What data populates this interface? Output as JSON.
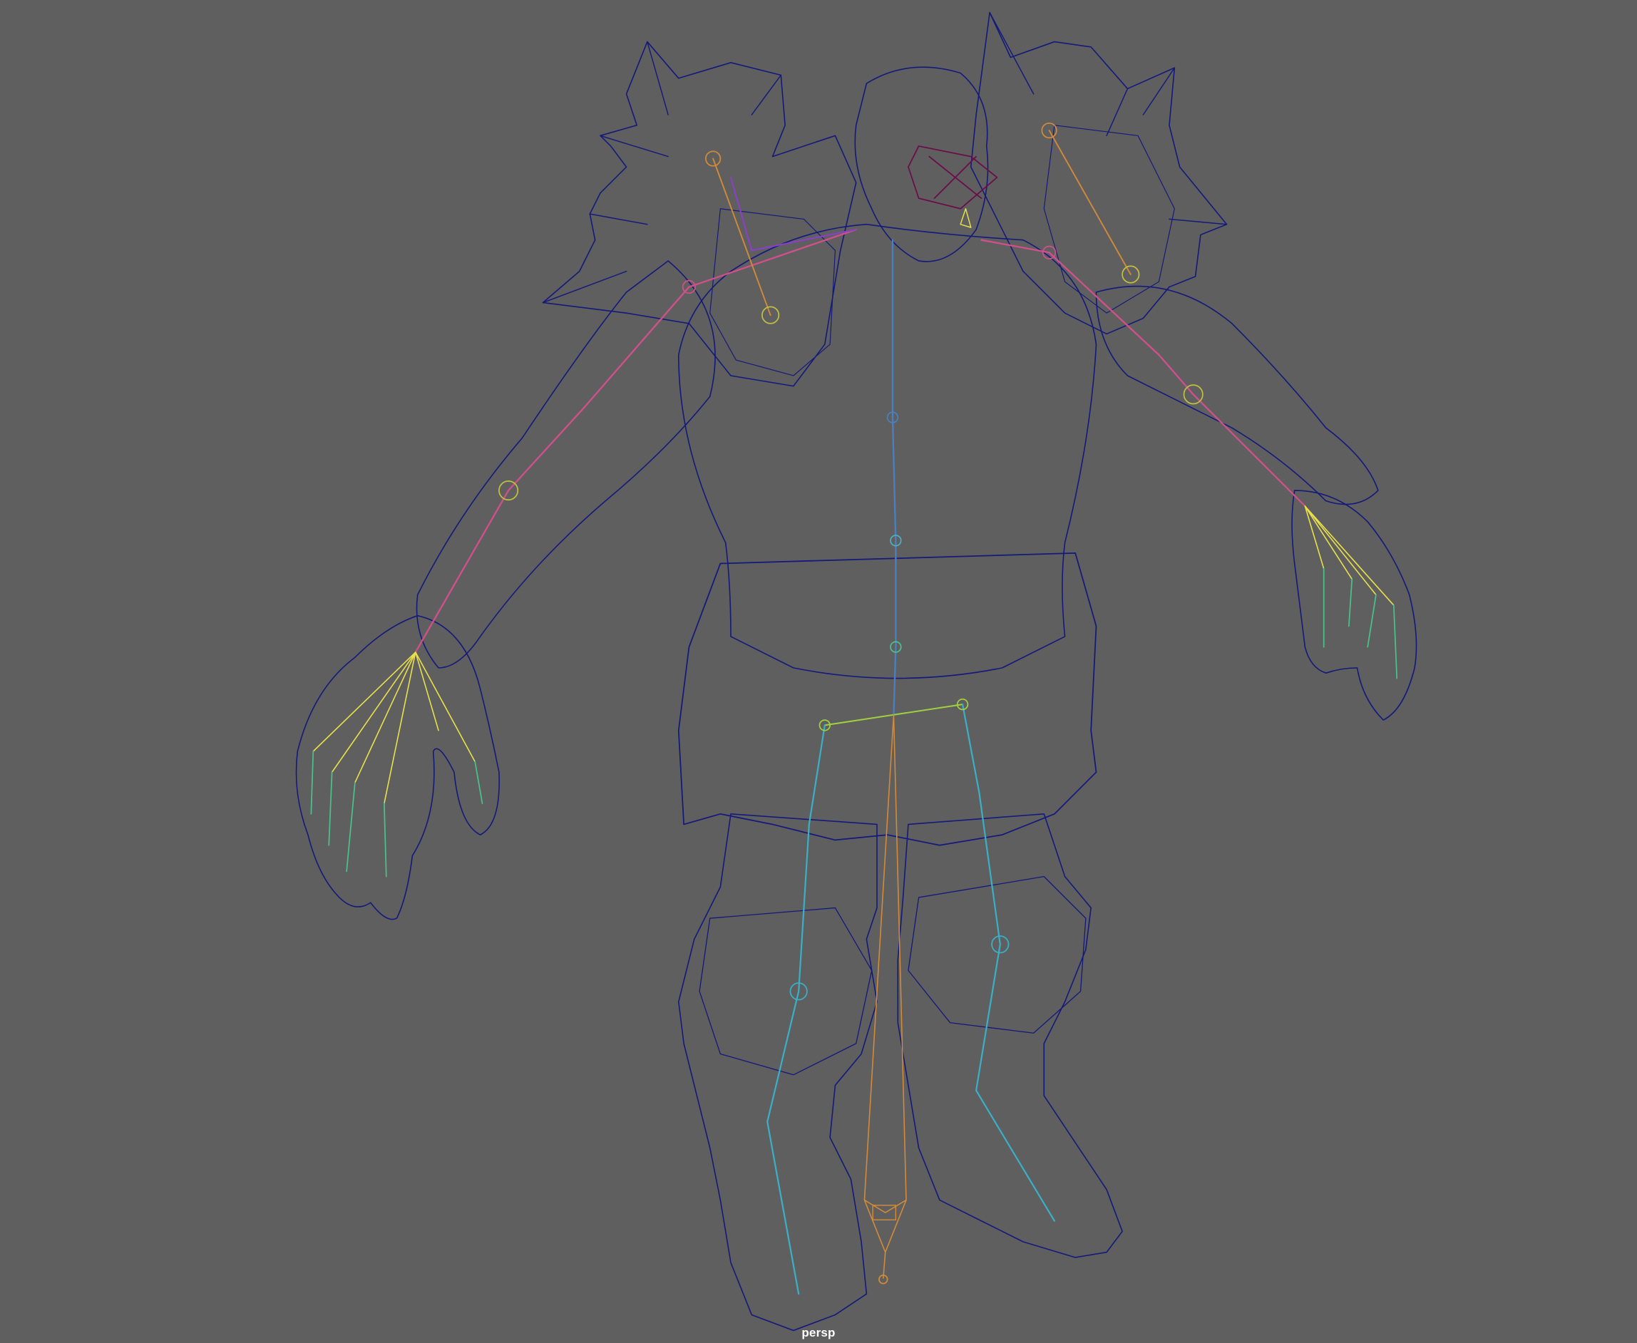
{
  "viewport": {
    "camera_label": "persp",
    "background_color": "#5f5f5f",
    "display_mode": "wireframe"
  },
  "colors": {
    "wireframe": "#141a7a",
    "head_joints": "#6a0d4a",
    "spine_joints": "#4a7fc0",
    "arm_joints": "#d0508a",
    "hand_joints": "#e8e04a",
    "finger_joints": "#4ac08a",
    "leg_joints": "#3ab0c8",
    "ik_handle": "#d08a3a",
    "clavicle_joints": "#8a40c8"
  },
  "icons": {
    "joint": "joint-sphere-icon",
    "locator": "pole-vector-locator-icon"
  }
}
